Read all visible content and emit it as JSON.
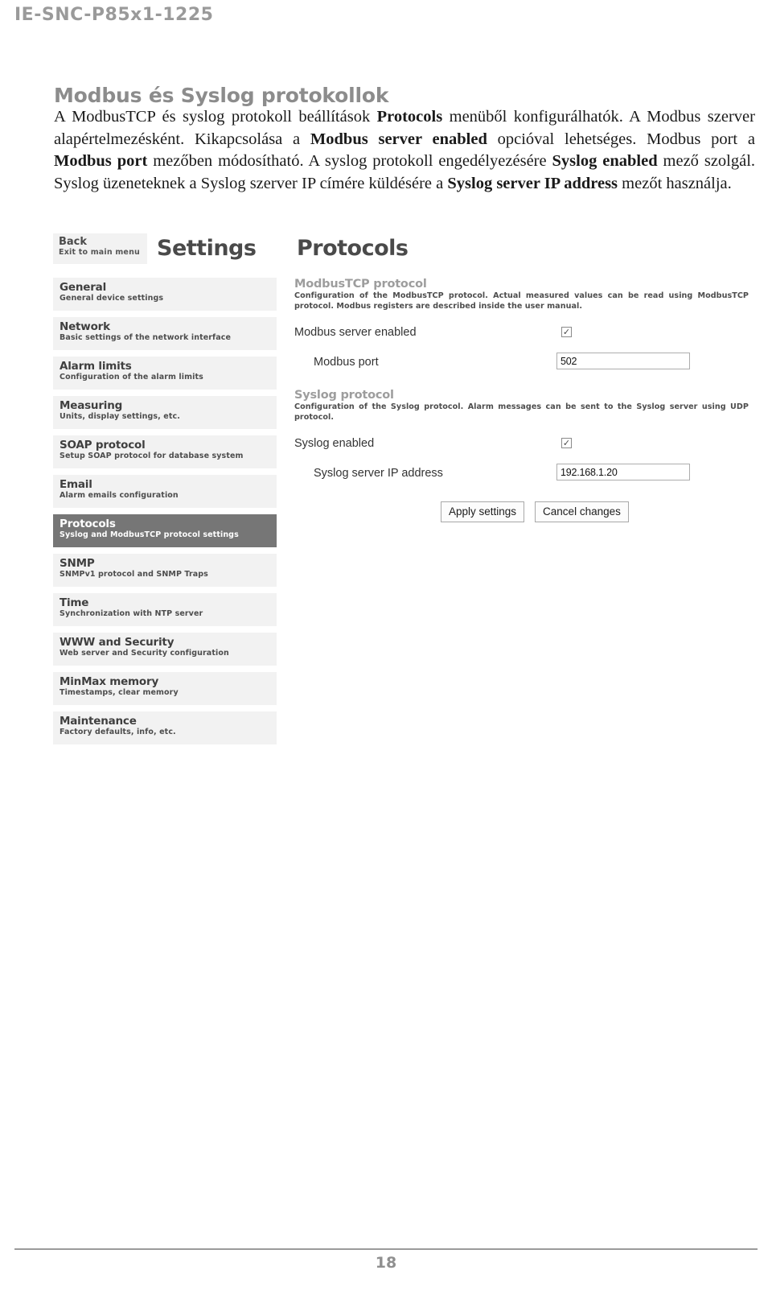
{
  "document": {
    "header_code": "IE-SNC-P85x1-1225",
    "page_number": "18",
    "section_title": "Modbus és Syslog protokollok",
    "paragraph": {
      "p1": "A ModbusTCP és syslog protokoll beállítások ",
      "b1": "Protocols",
      "p2": " menüből konfigurálhatók. A Modbus szerver alapértelmezésként. Kikapcsolása a ",
      "b2": "Modbus server enabled",
      "p3": " opcióval lehetséges. Modbus port a ",
      "b3": "Modbus port",
      "p4": " mezőben módosítható. A syslog protokoll engedélyezésére ",
      "b4": "Syslog enabled",
      "p5": " mező szolgál. Syslog üzeneteknek a Syslog szerver IP címére küldésére a ",
      "b5": "Syslog server IP address",
      "p6": " mezőt használja."
    }
  },
  "device_ui": {
    "back_button": {
      "label": "Back",
      "sublabel": "Exit to main menu"
    },
    "header": {
      "app_title": "Settings",
      "page_title": "Protocols"
    },
    "sidebar": {
      "items": [
        {
          "title": "General",
          "subtitle": "General device settings",
          "active": false
        },
        {
          "title": "Network",
          "subtitle": "Basic settings of the network interface",
          "active": false
        },
        {
          "title": "Alarm limits",
          "subtitle": "Configuration of the alarm limits",
          "active": false
        },
        {
          "title": "Measuring",
          "subtitle": "Units, display settings, etc.",
          "active": false
        },
        {
          "title": "SOAP protocol",
          "subtitle": "Setup SOAP protocol for database system",
          "active": false
        },
        {
          "title": "Email",
          "subtitle": "Alarm emails configuration",
          "active": false
        },
        {
          "title": "Protocols",
          "subtitle": "Syslog and ModbusTCP protocol settings",
          "active": true
        },
        {
          "title": "SNMP",
          "subtitle": "SNMPv1 protocol and SNMP Traps",
          "active": false
        },
        {
          "title": "Time",
          "subtitle": "Synchronization with NTP server",
          "active": false
        },
        {
          "title": "WWW and Security",
          "subtitle": "Web server and Security configuration",
          "active": false
        },
        {
          "title": "MinMax memory",
          "subtitle": "Timestamps, clear memory",
          "active": false
        },
        {
          "title": "Maintenance",
          "subtitle": "Factory defaults, info, etc.",
          "active": false
        }
      ]
    },
    "panel": {
      "modbus": {
        "group_title": "ModbusTCP protocol",
        "group_description": "Configuration of the ModbusTCP protocol. Actual measured values can be read using ModbusTCP protocol. Modbus registers are described inside the user manual.",
        "server_enabled_label": "Modbus server enabled",
        "server_enabled_checked": true,
        "checkmark": "✓",
        "port_label": "Modbus port",
        "port_value": "502"
      },
      "syslog": {
        "group_title": "Syslog protocol",
        "group_description": "Configuration of the Syslog protocol. Alarm messages can be sent to the Syslog server using UDP protocol.",
        "enabled_label": "Syslog enabled",
        "enabled_checked": true,
        "checkmark": "✓",
        "server_ip_label": "Syslog server IP address",
        "server_ip_value": "192.168.1.20"
      },
      "actions": {
        "apply_label": "Apply settings",
        "cancel_label": "Cancel changes"
      }
    }
  },
  "colors": {
    "header_gray": "#9a9a9a",
    "title_gray": "#8c8c8c",
    "menu_bg": "#f2f2f2",
    "menu_active_bg": "#767676"
  }
}
